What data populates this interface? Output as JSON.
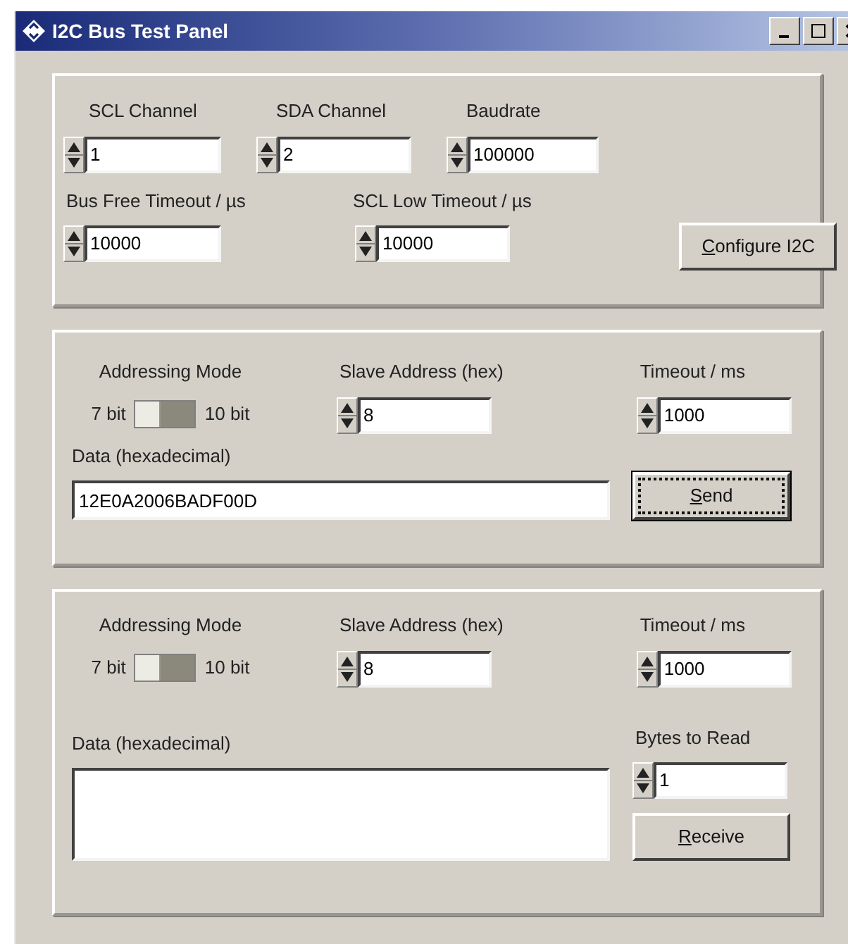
{
  "window": {
    "title": "I2C Bus Test Panel"
  },
  "config": {
    "fields": [
      {
        "label": "SCL Channel",
        "value": "1"
      },
      {
        "label": "SDA Channel",
        "value": "2"
      },
      {
        "label": "Baudrate",
        "value": "100000"
      },
      {
        "label": "Bus Free Timeout / µs",
        "value": "10000"
      },
      {
        "label": "SCL Low Timeout / µs",
        "value": "10000"
      }
    ],
    "button": {
      "label": "Configure I2C",
      "focused": false
    }
  },
  "send": {
    "addressing": {
      "label": "Addressing Mode",
      "options": [
        "7 bit",
        "10 bit"
      ],
      "ten_bit": false
    },
    "slave_address": {
      "label": "Slave Address (hex)",
      "value": "8"
    },
    "timeout": {
      "label": "Timeout / ms",
      "value": "1000"
    },
    "data": {
      "label": "Data (hexadecimal)",
      "value": "12E0A2006BADF00D"
    },
    "button": {
      "label": "Send",
      "focused": true
    }
  },
  "receive": {
    "addressing": {
      "label": "Addressing Mode",
      "options": [
        "7 bit",
        "10 bit"
      ],
      "ten_bit": false
    },
    "slave_address": {
      "label": "Slave Address (hex)",
      "value": "8"
    },
    "timeout": {
      "label": "Timeout / ms",
      "value": "1000"
    },
    "data": {
      "label": "Data (hexadecimal)"
    },
    "bytes_to_read": {
      "label": "Bytes to Read",
      "value": "1"
    },
    "button": {
      "label": "Receive",
      "focused": false
    }
  }
}
